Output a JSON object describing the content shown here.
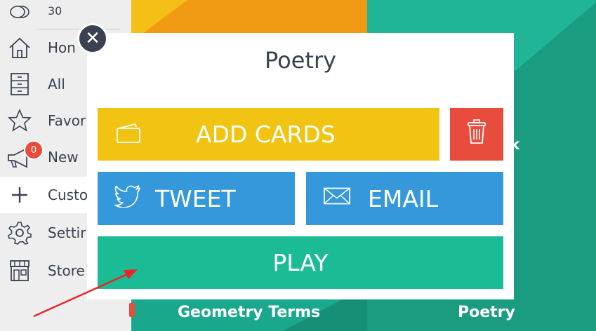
{
  "sidebar": {
    "coins": "30",
    "items": [
      {
        "label": "Hon",
        "icon": "home-icon"
      },
      {
        "label": "All",
        "icon": "cabinet-icon"
      },
      {
        "label": "Favor",
        "icon": "star-icon"
      },
      {
        "label": "New",
        "icon": "megaphone-icon"
      },
      {
        "label": "Custo",
        "icon": "plus-icon"
      },
      {
        "label": "Settir",
        "icon": "gear-icon"
      },
      {
        "label": "Store",
        "icon": "store-icon"
      }
    ],
    "new_badge": "0"
  },
  "background": {
    "tiles": [
      "Geometry Terms",
      "Poetry",
      "rk"
    ]
  },
  "modal": {
    "title": "Poetry",
    "add_cards_label": "ADD CARDS",
    "tweet_label": "TWEET",
    "email_label": "EMAIL",
    "play_label": "PLAY",
    "close_glyph": "✕"
  },
  "colors": {
    "add": "#f1c312",
    "delete": "#e74c3c",
    "share": "#3498db",
    "play": "#1bbc95",
    "annotation_arrow": "#e8262a"
  }
}
